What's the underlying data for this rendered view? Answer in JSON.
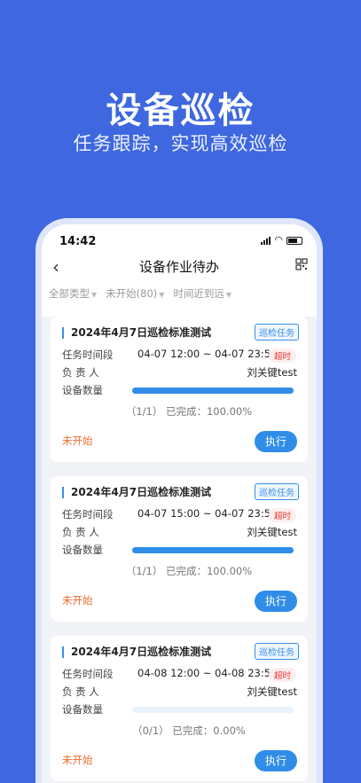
{
  "hero": {
    "title": "设备巡检",
    "subtitle": "任务跟踪，实现高效巡检"
  },
  "status_bar": {
    "time": "14:42"
  },
  "header": {
    "title": "设备作业待办"
  },
  "filters": [
    "全部类型",
    "未开始(80)",
    "时间近到远"
  ],
  "labels": {
    "time": "任务时间段",
    "person": "负 责 人",
    "devices": "设备数量",
    "execute": "执行"
  },
  "cards": [
    {
      "title": "2024年4月7日巡检标准测试",
      "type": "巡检任务",
      "time_range": "04-07 12:00 ~ 04-07 23:59",
      "overdue": "超时",
      "person": "刘关键test",
      "progress": 1.0,
      "progress_text": "（1/1） 已完成：100.00%",
      "status": "未开始"
    },
    {
      "title": "2024年4月7日巡检标准测试",
      "type": "巡检任务",
      "time_range": "04-07 15:00 ~ 04-07 23:59",
      "overdue": "超时",
      "person": "刘关键test",
      "progress": 1.0,
      "progress_text": "（1/1） 已完成：100.00%",
      "status": "未开始"
    },
    {
      "title": "2024年4月7日巡检标准测试",
      "type": "巡检任务",
      "time_range": "04-08 12:00 ~ 04-08 23:59",
      "overdue": "超时",
      "person": "刘关键test",
      "progress": 0.0,
      "progress_text": "（0/1） 已完成：0.00%",
      "status": "未开始"
    }
  ]
}
